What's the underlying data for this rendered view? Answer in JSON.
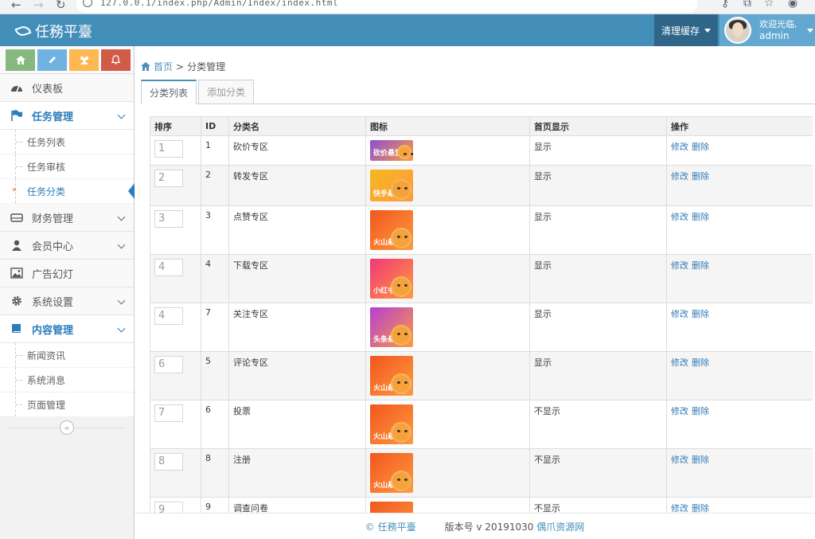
{
  "browser": {
    "url": "127.0.0.1/index.php/Admin/Index/index.html"
  },
  "brand": {
    "title": "任務平臺"
  },
  "navbar": {
    "clear_cache": "清理缓存",
    "welcome": "欢迎光临,",
    "username": "admin"
  },
  "sidebar": {
    "items": [
      {
        "label": "仪表板",
        "icon": "dashboard-icon"
      },
      {
        "label": "任务管理",
        "icon": "flag-icon"
      },
      {
        "label": "财务管理",
        "icon": "drive-icon"
      },
      {
        "label": "会员中心",
        "icon": "user-icon"
      },
      {
        "label": "广告幻灯",
        "icon": "image-icon"
      },
      {
        "label": "系统设置",
        "icon": "gear-icon"
      },
      {
        "label": "内容管理",
        "icon": "book-icon"
      }
    ],
    "task_sub": [
      "任务列表",
      "任务审核",
      "任务分类"
    ],
    "content_sub": [
      "新闻资讯",
      "系统消息",
      "页面管理"
    ]
  },
  "breadcrumb": {
    "home": "首页",
    "sep": ">",
    "current": "分类管理"
  },
  "tabs": {
    "list": "分类列表",
    "add": "添加分类"
  },
  "table": {
    "headers": {
      "sort": "排序",
      "id": "ID",
      "name": "分类名",
      "icon": "图标",
      "home": "首页显示",
      "ops": "操作"
    },
    "edit_label": "修改",
    "delete_label": "删除",
    "rows": [
      {
        "sort": "1",
        "id": "1",
        "name": "砍价专区",
        "home": "显示",
        "thumb_text": "砍价悬赏",
        "color": "#8a4fd8"
      },
      {
        "sort": "2",
        "id": "2",
        "name": "转发专区",
        "home": "显示",
        "thumb_text": "快手悬赏",
        "color": "#f5b820"
      },
      {
        "sort": "3",
        "id": "3",
        "name": "点赞专区",
        "home": "显示",
        "thumb_text": "火山悬赏",
        "color": "#f2561f"
      },
      {
        "sort": "4",
        "id": "4",
        "name": "下载专区",
        "home": "显示",
        "thumb_text": "小红书悬赏",
        "color": "#f0377a"
      },
      {
        "sort": "4",
        "id": "7",
        "name": "关注专区",
        "home": "显示",
        "thumb_text": "头条悬赏",
        "color": "#b43fd6"
      },
      {
        "sort": "6",
        "id": "5",
        "name": "评论专区",
        "home": "显示",
        "thumb_text": "火山悬赏",
        "color": "#f2561f"
      },
      {
        "sort": "7",
        "id": "6",
        "name": "投票",
        "home": "不显示",
        "thumb_text": "火山悬赏",
        "color": "#f2561f"
      },
      {
        "sort": "8",
        "id": "8",
        "name": "注册",
        "home": "不显示",
        "thumb_text": "火山悬赏",
        "color": "#f2561f"
      },
      {
        "sort": "9",
        "id": "9",
        "name": "调查问卷",
        "home": "不显示",
        "thumb_text": "火山悬赏",
        "color": "#f2561f"
      }
    ]
  },
  "footer": {
    "brand": "© 任務平臺",
    "version": "版本号 v 20191030",
    "source": "偶爪资源网"
  }
}
